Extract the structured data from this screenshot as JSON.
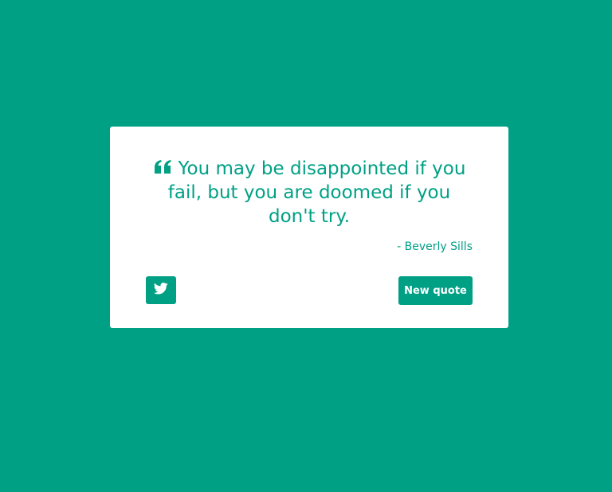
{
  "quote": {
    "text": "You may be disappointed if you fail, but you are doomed if you don't try.",
    "author": "- Beverly Sills",
    "icon": "quote-left-icon"
  },
  "actions": {
    "tweet_icon": "twitter-icon",
    "new_quote_label": "New quote"
  },
  "colors": {
    "accent": "#00a085",
    "card_background": "#ffffff"
  }
}
